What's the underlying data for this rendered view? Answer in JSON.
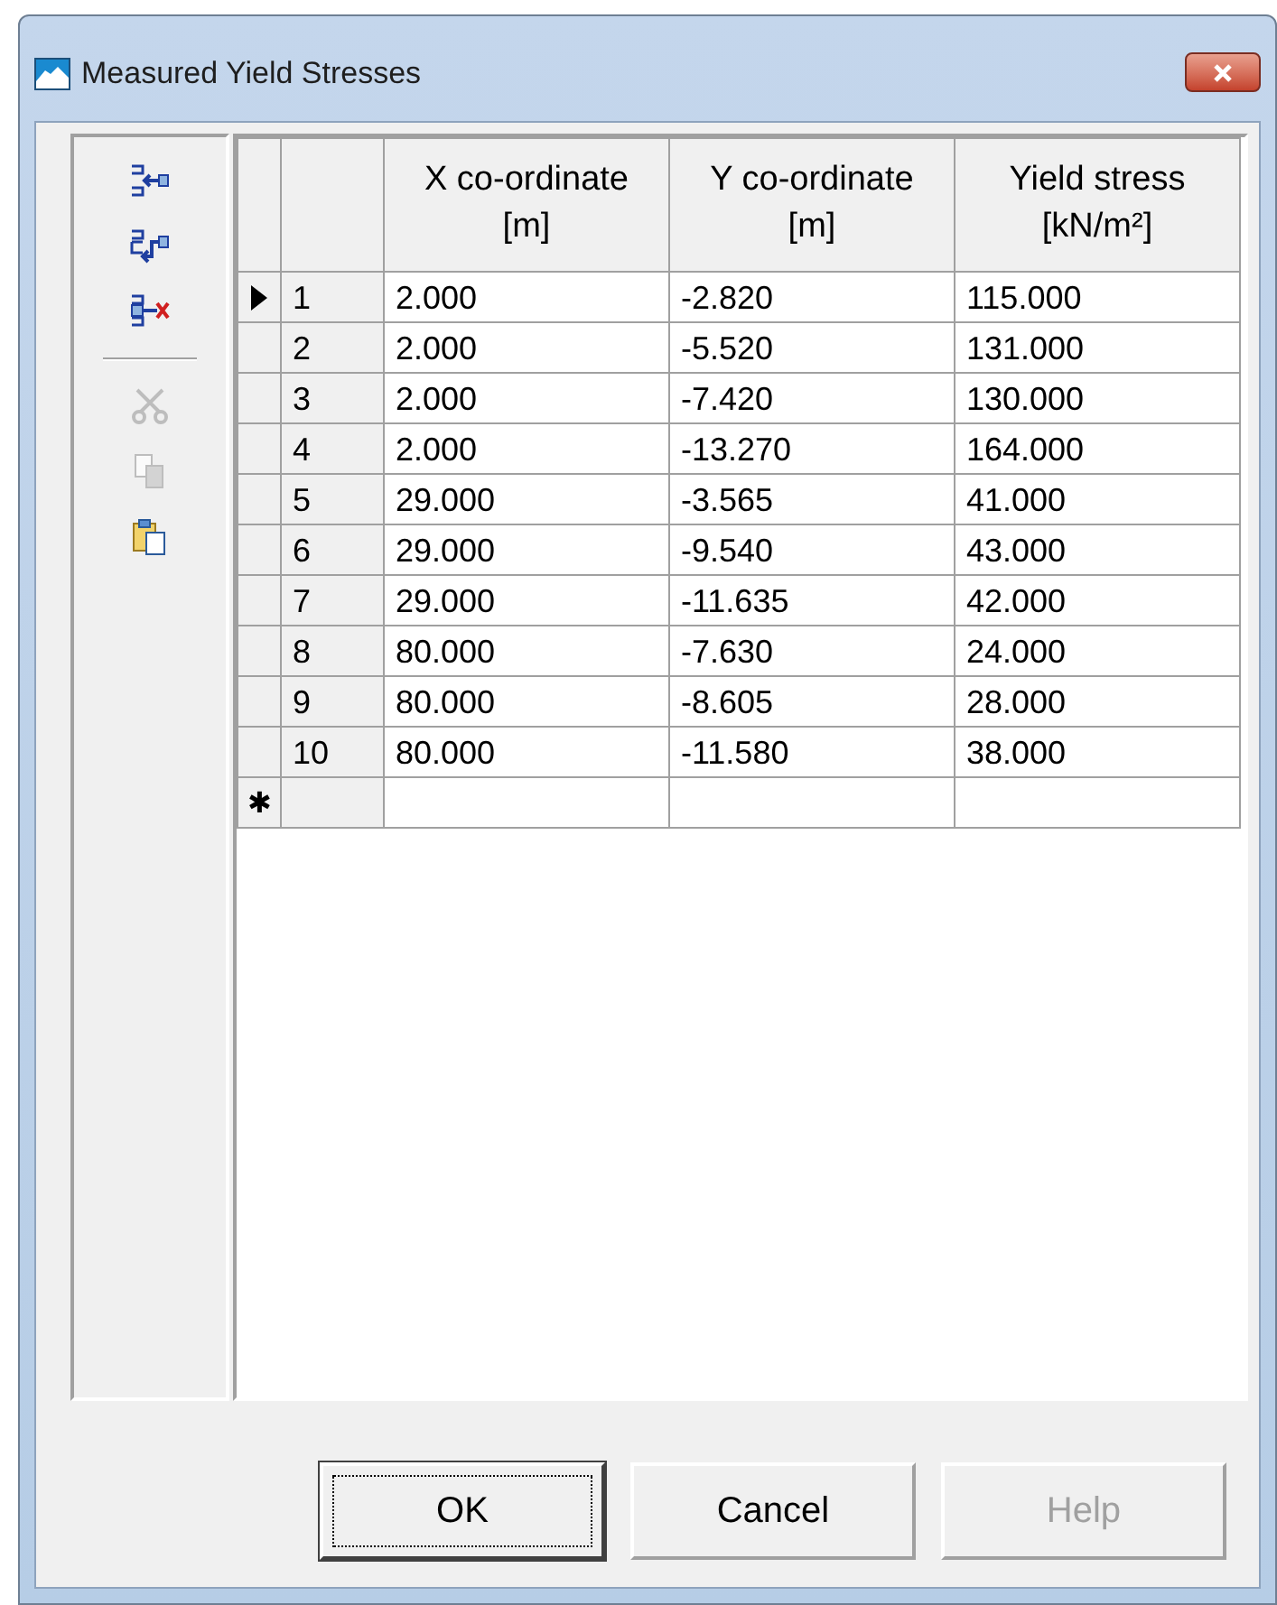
{
  "window": {
    "title": "Measured Yield Stresses"
  },
  "toolbar": [
    {
      "kind": "insert-row",
      "disabled": false
    },
    {
      "kind": "add-row",
      "disabled": false
    },
    {
      "kind": "delete-row",
      "disabled": false
    },
    {
      "kind": "separator"
    },
    {
      "kind": "cut",
      "disabled": true
    },
    {
      "kind": "copy",
      "disabled": true
    },
    {
      "kind": "paste",
      "disabled": false
    }
  ],
  "table": {
    "columns": [
      "X co-ordinate\n[m]",
      "Y co-ordinate\n[m]",
      "Yield stress\n[kN/m²]"
    ],
    "rows": [
      {
        "number": "1",
        "current": true,
        "cells": [
          "2.000",
          "-2.820",
          "115.000"
        ]
      },
      {
        "number": "2",
        "current": false,
        "cells": [
          "2.000",
          "-5.520",
          "131.000"
        ]
      },
      {
        "number": "3",
        "current": false,
        "cells": [
          "2.000",
          "-7.420",
          "130.000"
        ]
      },
      {
        "number": "4",
        "current": false,
        "cells": [
          "2.000",
          "-13.270",
          "164.000"
        ]
      },
      {
        "number": "5",
        "current": false,
        "cells": [
          "29.000",
          "-3.565",
          "41.000"
        ]
      },
      {
        "number": "6",
        "current": false,
        "cells": [
          "29.000",
          "-9.540",
          "43.000"
        ]
      },
      {
        "number": "7",
        "current": false,
        "cells": [
          "29.000",
          "-11.635",
          "42.000"
        ]
      },
      {
        "number": "8",
        "current": false,
        "cells": [
          "80.000",
          "-7.630",
          "24.000"
        ]
      },
      {
        "number": "9",
        "current": false,
        "cells": [
          "80.000",
          "-8.605",
          "28.000"
        ]
      },
      {
        "number": "10",
        "current": false,
        "cells": [
          "80.000",
          "-11.580",
          "38.000"
        ]
      }
    ],
    "new_row_marker": "✱"
  },
  "buttons": [
    {
      "label": "OK",
      "default": true,
      "disabled": false
    },
    {
      "label": "Cancel",
      "default": false,
      "disabled": false
    },
    {
      "label": "Help",
      "default": false,
      "disabled": true
    }
  ]
}
